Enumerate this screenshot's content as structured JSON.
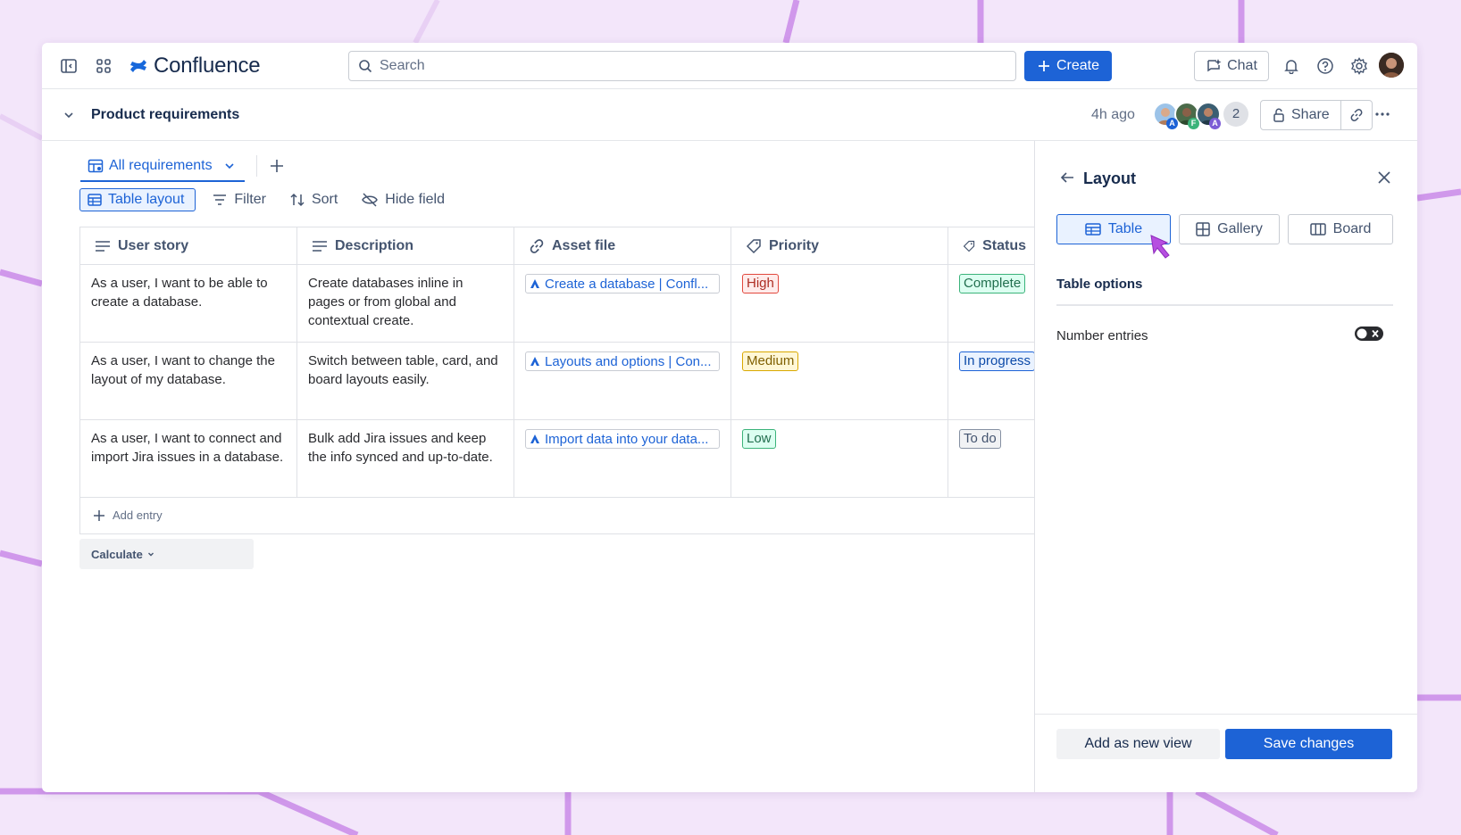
{
  "nav": {
    "app_name": "Confluence",
    "search_placeholder": "Search",
    "create_label": "Create",
    "chat_label": "Chat"
  },
  "page": {
    "title": "Product requirements",
    "edited": "4h ago",
    "collaborator_initials": [
      "A",
      "F",
      "A"
    ],
    "extra_count": "2",
    "share_label": "Share"
  },
  "view": {
    "tab_label": "All requirements",
    "toolbar": {
      "table_layout": "Table layout",
      "filter": "Filter",
      "sort": "Sort",
      "hide_field": "Hide field"
    }
  },
  "table": {
    "headers": [
      "User story",
      "Description",
      "Asset file",
      "Priority",
      "Status"
    ],
    "rows": [
      {
        "story": "As a user, I want to be able to create a database.",
        "description": "Create databases inline in pages or from global and contextual create.",
        "asset": "Create a database | Confl...",
        "priority": "High",
        "status": "Complete"
      },
      {
        "story": "As a user, I want to change the layout of my database.",
        "description": "Switch between table, card, and board layouts easily.",
        "asset": "Layouts and options | Con...",
        "priority": "Medium",
        "status": "In progress"
      },
      {
        "story": "As a user, I want to connect and import Jira issues in a database.",
        "description": "Bulk add Jira issues and keep the info synced and up-to-date.",
        "asset": "Import data into your data...",
        "priority": "Low",
        "status": "To do"
      }
    ],
    "add_entry": "Add entry",
    "calculate": "Calculate"
  },
  "panel": {
    "title": "Layout",
    "layouts": [
      "Table",
      "Gallery",
      "Board"
    ],
    "selected_layout": "Table",
    "options_title": "Table options",
    "number_entries_label": "Number entries",
    "number_entries_enabled": false,
    "add_view_label": "Add as new view",
    "save_label": "Save changes"
  },
  "colors": {
    "accent": "#1d63d6",
    "background": "#f3e6fa",
    "decor_lines": "#c98ae8",
    "priority_high": "#e2483d",
    "priority_medium": "#d9a800",
    "priority_low": "#3bb37a",
    "status_complete": "#3bb37a",
    "status_in_progress": "#1d63d6",
    "status_todo": "#8590a2"
  }
}
